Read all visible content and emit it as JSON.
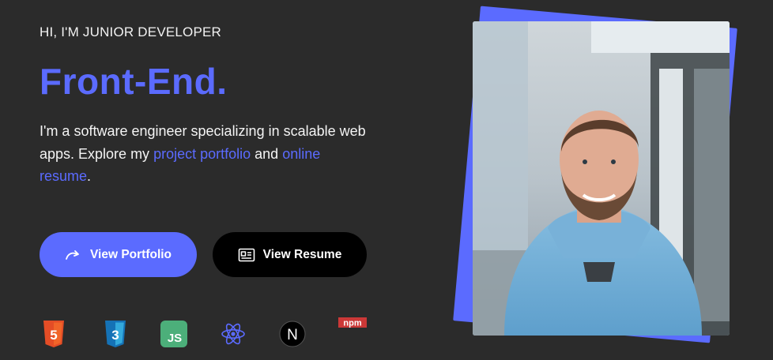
{
  "hero": {
    "eyebrow": "HI, I'M JUNIOR DEVELOPER",
    "headline": "Front-End.",
    "intro_before": "I'm a software engineer specializing in scalable web apps. Explore my ",
    "link_portfolio": "project portfolio",
    "intro_middle": " and ",
    "link_resume": "online resume",
    "intro_end": "."
  },
  "buttons": {
    "portfolio_label": "View Portfolio",
    "portfolio_icon": "redo-arrow-icon",
    "resume_label": "View Resume",
    "resume_icon": "resume-icon"
  },
  "tech_stack": [
    {
      "name": "html5-icon",
      "color": "#e44d26",
      "text": "5"
    },
    {
      "name": "css3-icon",
      "color": "#1572b6",
      "text": "3"
    },
    {
      "name": "javascript-icon",
      "color": "#4caf7a",
      "text": "JS"
    },
    {
      "name": "react-icon",
      "color": "#5b6bff"
    },
    {
      "name": "nextjs-icon",
      "color": "#000000",
      "text": "N"
    },
    {
      "name": "npm-icon",
      "color": "#cb3837",
      "text": "npm"
    }
  ],
  "colors": {
    "background": "#2b2b2b",
    "accent": "#5b6bff",
    "resume_button": "#000000"
  }
}
